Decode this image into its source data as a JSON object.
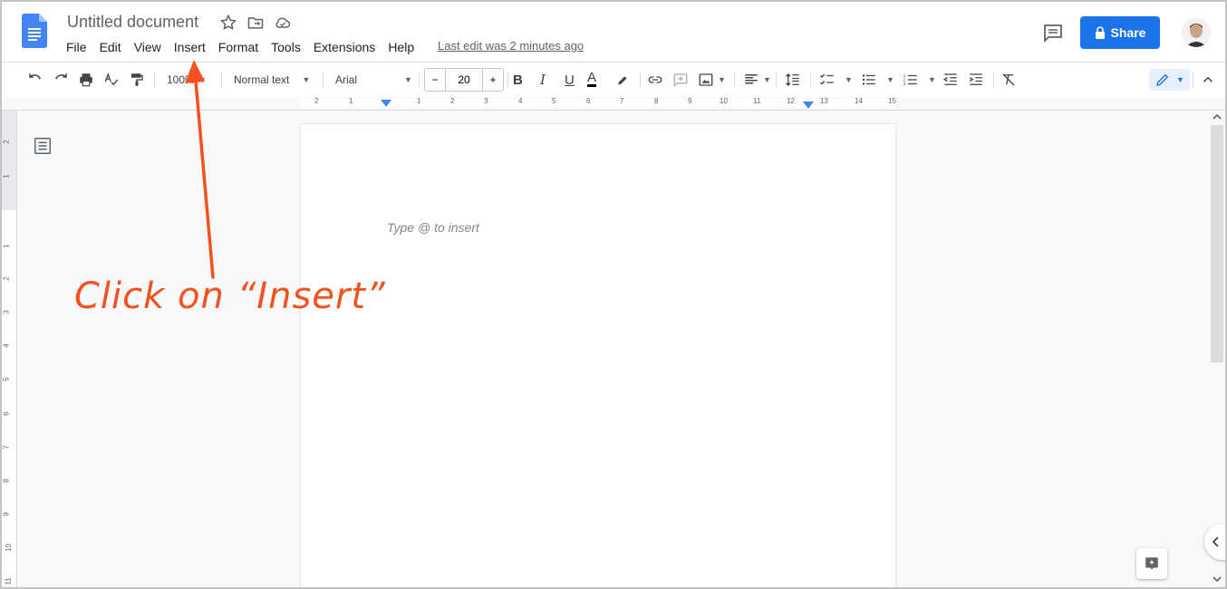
{
  "header": {
    "doc_title": "Untitled document",
    "menu": [
      "File",
      "Edit",
      "View",
      "Insert",
      "Format",
      "Tools",
      "Extensions",
      "Help"
    ],
    "last_edit": "Last edit was 2 minutes ago",
    "share_label": "Share"
  },
  "toolbar": {
    "zoom": "100%",
    "style": "Normal text",
    "font": "Arial",
    "font_size": "20",
    "minus": "−",
    "plus": "+"
  },
  "ruler": {
    "top_labels": [
      "2",
      "1",
      "1",
      "1",
      "2",
      "3",
      "4",
      "5",
      "6",
      "7",
      "8",
      "9",
      "10",
      "11",
      "12",
      "13",
      "14",
      "15"
    ],
    "left_labels": [
      "2",
      "1",
      "1",
      "2",
      "3",
      "4",
      "5",
      "6",
      "7",
      "8",
      "9",
      "10",
      "11"
    ]
  },
  "document": {
    "placeholder": "Type @ to insert"
  },
  "annotation": {
    "text": "Click on “Insert”"
  },
  "colors": {
    "accent": "#1a73e8",
    "annotation": "#f4511e"
  }
}
